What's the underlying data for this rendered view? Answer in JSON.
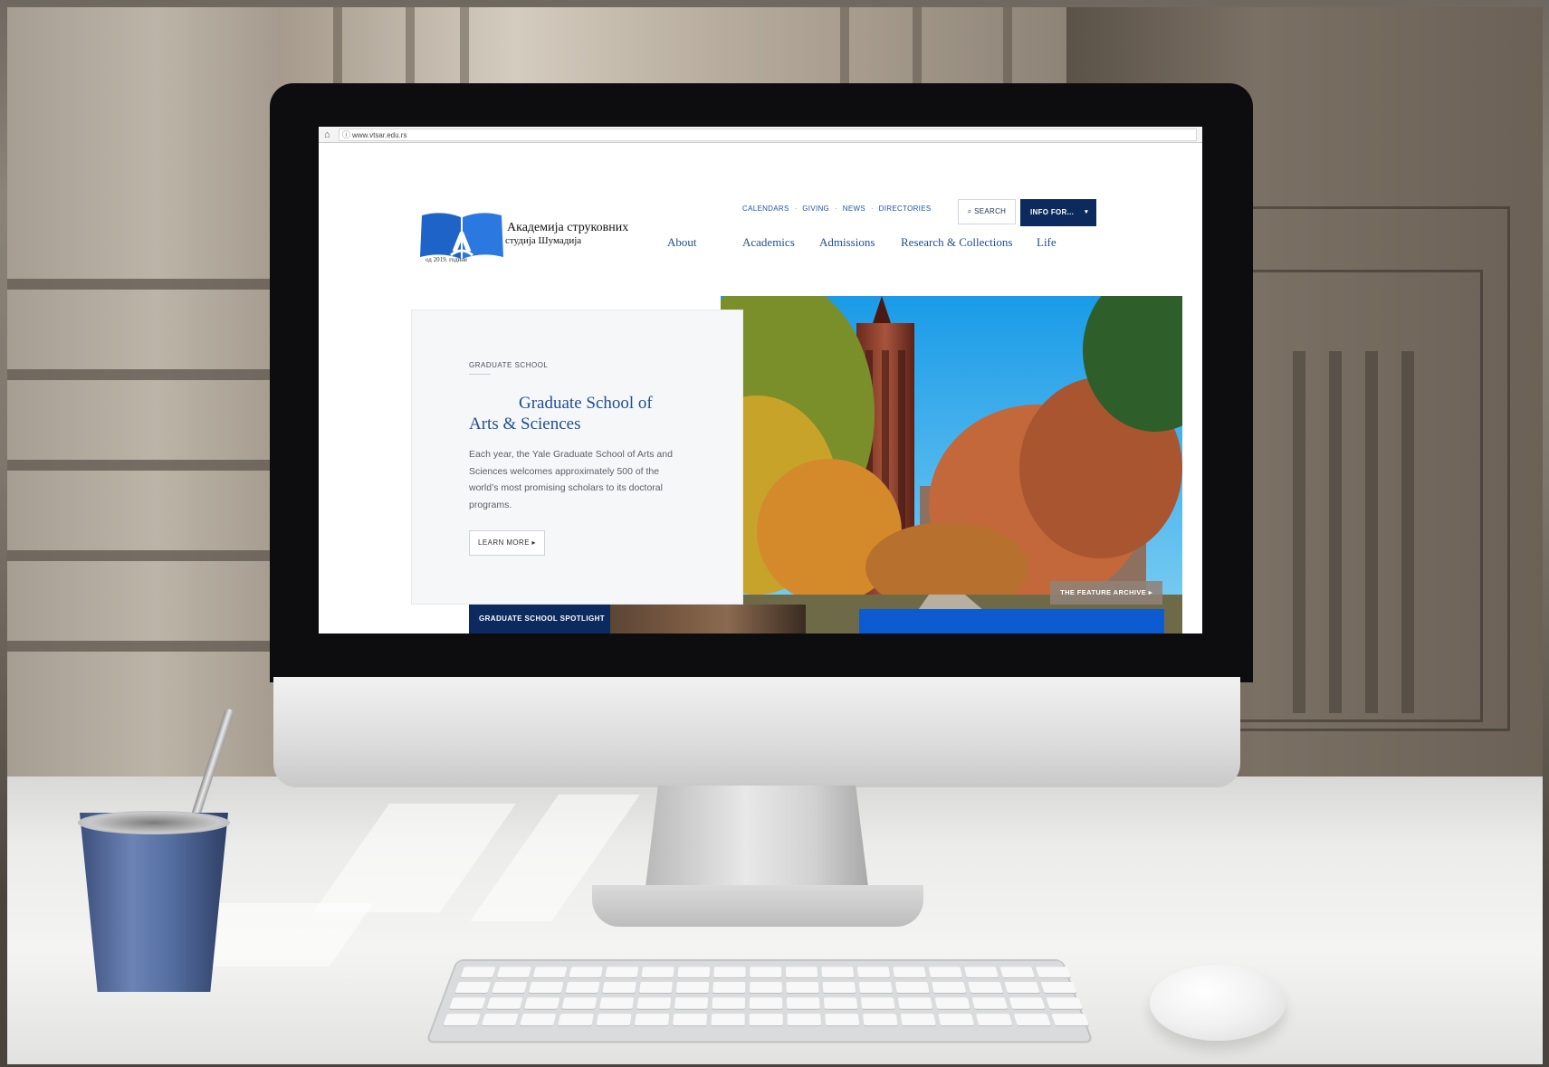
{
  "browser": {
    "url": "www.vtsar.edu.rs"
  },
  "logo": {
    "title": "Академија струковних",
    "subtitle": "студија Шумадија",
    "year": "од 2019. године",
    "letter": "A"
  },
  "utility_nav": {
    "items": [
      "CALENDARS",
      "GIVING",
      "NEWS",
      "DIRECTORIES"
    ],
    "separator": "·"
  },
  "search": {
    "label": "SEARCH"
  },
  "info_for": {
    "label": "INFO FOR...",
    "caret": "▾"
  },
  "main_nav": {
    "items": [
      "About",
      "Academics",
      "Admissions",
      "Research & Collections",
      "Life"
    ]
  },
  "hero": {
    "eyebrow": "GRADUATE SCHOOL",
    "heading_line1": "Graduate School of",
    "heading_line2": "Arts & Sciences",
    "body": "Each year, the Yale Graduate School of Arts and Sciences welcomes approximately 500 of the world’s most promising scholars to its doctoral programs.",
    "learn_more": "LEARN MORE ▸",
    "feature_archive": "THE FEATURE ARCHIVE ▸",
    "spotlight": "GRADUATE SCHOOL SPOTLIGHT"
  },
  "colors": {
    "navy": "#0c2a5e",
    "link_blue": "#1f4f8e",
    "logo_blue": "#1e63c8",
    "accent_blue": "#0c5bd1"
  },
  "icons": {
    "home": "home-icon",
    "info": "info-icon",
    "search": "search-icon",
    "caret": "caret-down-icon"
  }
}
